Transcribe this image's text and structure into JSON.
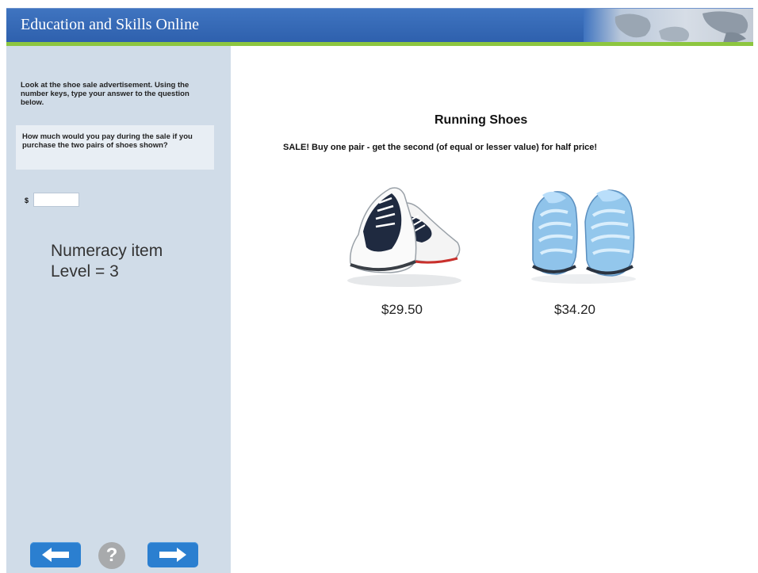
{
  "header": {
    "title": "Education and Skills Online"
  },
  "sidebar": {
    "instructions": "Look at the shoe sale advertisement. Using the number keys, type your answer to the question below.",
    "question": "How much would you pay during the sale if you purchase the two pairs of shoes shown?",
    "currency_symbol": "$",
    "answer_value": "",
    "note_line1": "Numeracy item",
    "note_line2": "Level = 3"
  },
  "footer": {
    "back_icon": "arrow-left-icon",
    "help_label": "?",
    "next_icon": "arrow-right-icon"
  },
  "ad": {
    "title": "Running Shoes",
    "sale_text": "SALE! Buy one pair - get the second (of equal or lesser value) for half price!",
    "products": [
      {
        "image": "navy-white-running-shoes",
        "price": "$29.50"
      },
      {
        "image": "light-blue-running-shoes",
        "price": "$34.20"
      }
    ]
  },
  "colors": {
    "header_blue": "#2e60ad",
    "accent_green": "#8dc63f",
    "sidebar_bg": "#d0dce8",
    "button_blue": "#2b7fd0"
  }
}
